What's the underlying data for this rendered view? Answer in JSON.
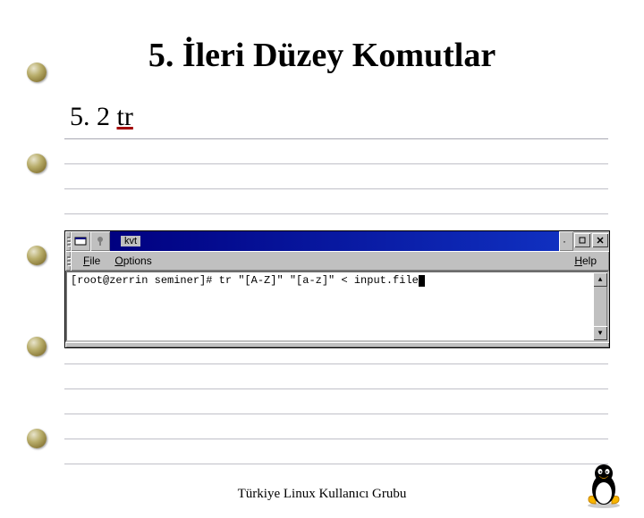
{
  "slide": {
    "title": "5. İleri Düzey Komutlar",
    "subtitle_num": "5. 2 ",
    "subtitle_cmd": "tr",
    "footer": "Türkiye Linux Kullanıcı Grubu"
  },
  "window": {
    "app_name": "kvt",
    "menus": {
      "file": "File",
      "options": "Options",
      "help": "Help"
    },
    "controls": {
      "min": "·",
      "max": "□",
      "close": "×"
    },
    "scroll": {
      "up": "▲",
      "down": "▼"
    },
    "terminal_line": "[root@zerrin seminer]# tr \"[A-Z]\" \"[a-z]\" < input.file"
  },
  "icons": {
    "tux": "tux-penguin",
    "marble": "spiral-bullet",
    "sysmenu": "window-system-menu"
  }
}
